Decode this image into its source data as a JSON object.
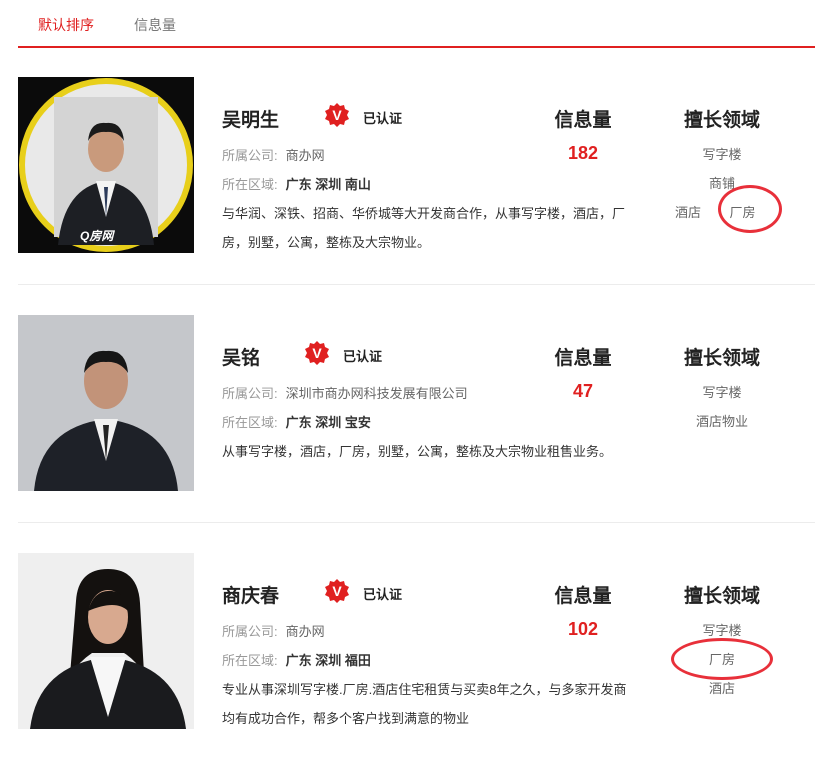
{
  "tabs": {
    "default_sort": "默认排序",
    "info_count": "信息量"
  },
  "columns": {
    "info": "信息量",
    "expertise": "擅长领域"
  },
  "labels": {
    "company": "所属公司:",
    "region": "所在区域:"
  },
  "verified_text": "已认证",
  "badge_letter": "V",
  "watermark": "Q房网",
  "colors": {
    "accent": "#e02020",
    "highlight_ring": "#e8303a"
  },
  "agents": [
    {
      "name": "吴明生",
      "company": "商办网",
      "region": "广东 深圳 南山",
      "description": "与华润、深铁、招商、华侨城等大开发商合作，从事写字楼，酒店，厂房，别墅，公寓，整栋及大宗物业。",
      "info_count": "182",
      "expertise": [
        "写字楼",
        "商铺",
        "酒店",
        "厂房"
      ]
    },
    {
      "name": "吴铭",
      "company": "深圳市商办网科技发展有限公司",
      "region": "广东 深圳 宝安",
      "description": "从事写字楼，酒店，厂房，别墅，公寓，整栋及大宗物业租售业务。",
      "info_count": "47",
      "expertise": [
        "写字楼",
        "酒店物业"
      ]
    },
    {
      "name": "商庆春",
      "company": "商办网",
      "region": "广东 深圳 福田",
      "description": "专业从事深圳写字楼.厂房.酒店住宅租赁与买卖8年之久，与多家开发商均有成功合作，帮多个客户找到满意的物业",
      "info_count": "102",
      "expertise": [
        "写字楼",
        "厂房",
        "酒店"
      ]
    }
  ]
}
